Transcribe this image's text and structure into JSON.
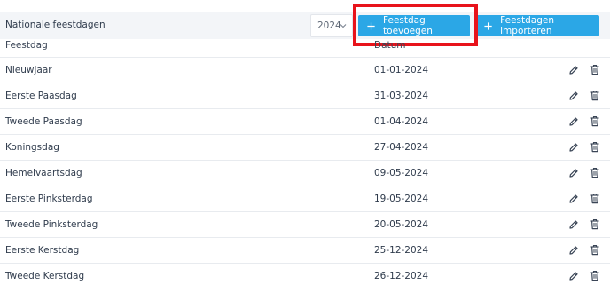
{
  "header": {
    "title": "Nationale feestdagen",
    "year": "2024",
    "add_button": "Feestdag toevoegen",
    "import_button": "Feestdagen importeren",
    "accent_color": "#2ba7e6",
    "highlight_color": "#e8131b"
  },
  "table": {
    "columns": [
      "Feestdag",
      "Datum"
    ],
    "rows": [
      {
        "name": "Nieuwjaar",
        "date": "01-01-2024"
      },
      {
        "name": "Eerste Paasdag",
        "date": "31-03-2024"
      },
      {
        "name": "Tweede Paasdag",
        "date": "01-04-2024"
      },
      {
        "name": "Koningsdag",
        "date": "27-04-2024"
      },
      {
        "name": "Hemelvaartsdag",
        "date": "09-05-2024"
      },
      {
        "name": "Eerste Pinksterdag",
        "date": "19-05-2024"
      },
      {
        "name": "Tweede Pinksterdag",
        "date": "20-05-2024"
      },
      {
        "name": "Eerste Kerstdag",
        "date": "25-12-2024"
      },
      {
        "name": "Tweede Kerstdag",
        "date": "26-12-2024"
      }
    ],
    "row_actions": [
      "pencil-icon",
      "trash-icon"
    ]
  }
}
